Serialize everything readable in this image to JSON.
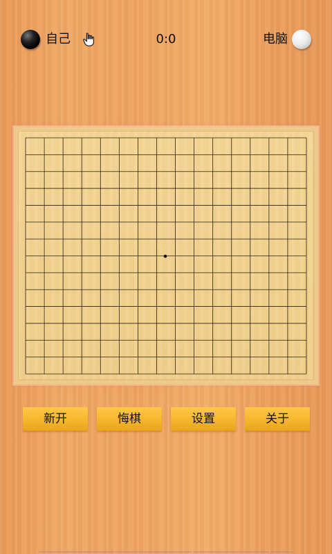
{
  "status": {
    "player_label": "自己",
    "score": "0:0",
    "computer_label": "电脑",
    "player_stone_color": "#000000",
    "computer_stone_color": "#ffffff",
    "turn_indicator": "hand-pointer-icon"
  },
  "board": {
    "columns": 15,
    "rows": 14,
    "line_color": "#2a2010",
    "center_star": "star-point",
    "stones": []
  },
  "buttons": {
    "new_game": "新开",
    "undo": "悔棋",
    "settings": "设置",
    "about": "关于"
  },
  "colors": {
    "button_gold": "#f5b62d",
    "board_wood": "#f0cf8b",
    "background_wood": "#eea463"
  }
}
